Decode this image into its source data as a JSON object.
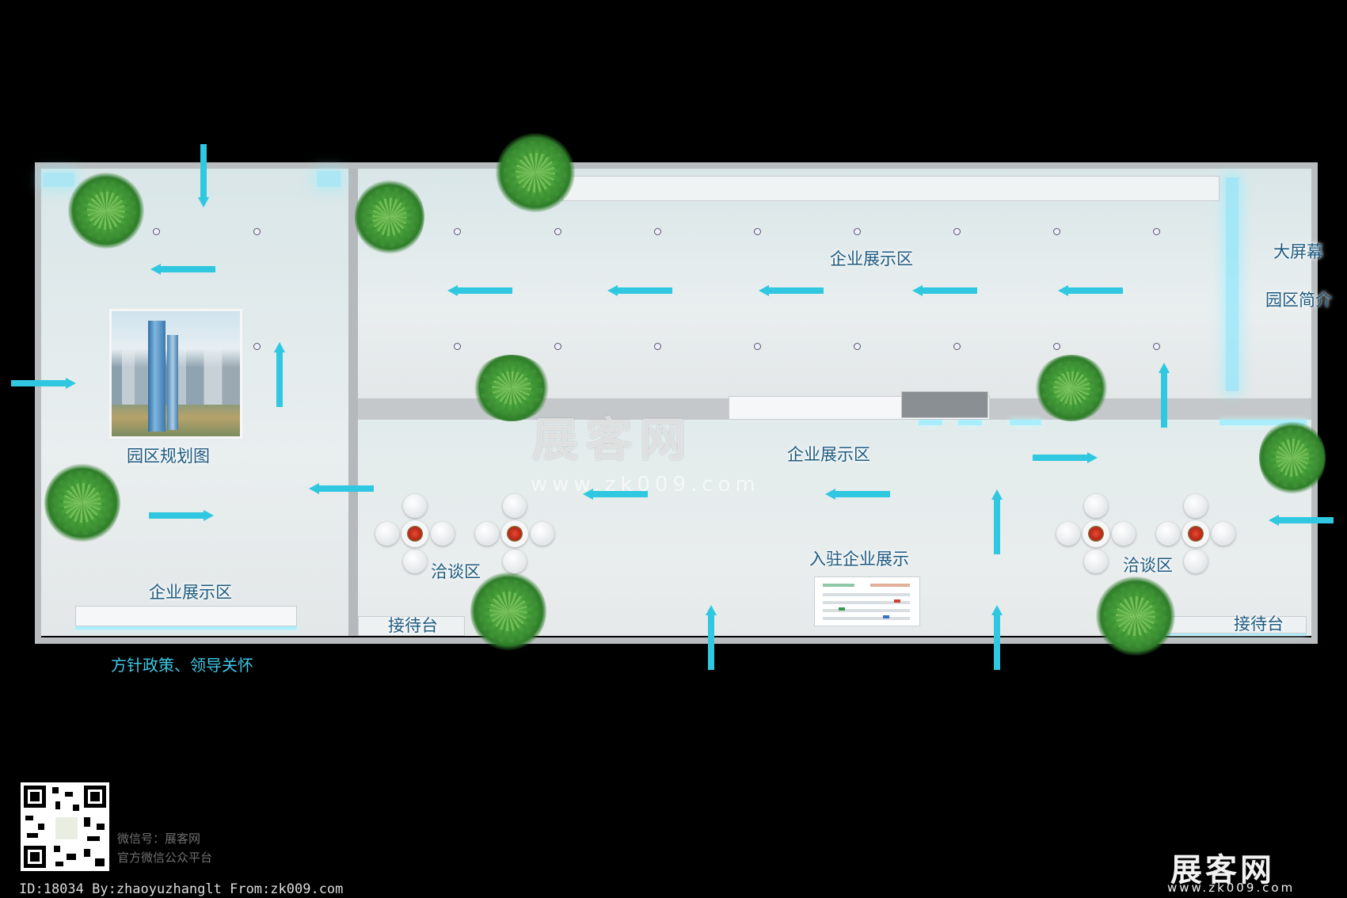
{
  "zones": {
    "enterprise_display_top": "企业展示区",
    "big_screen": "大屏幕",
    "park_intro": "园区简介",
    "park_plan": "园区规划图",
    "enterprise_display_mid": "企业展示区",
    "enterprise_display_left": "企业展示区",
    "negotiation_left": "洽谈区",
    "negotiation_right": "洽谈区",
    "resident_enterprise": "入驻企业展示",
    "reception_left": "接待台",
    "reception_right": "接待台",
    "policy_caption": "方针政策、领导关怀"
  },
  "watermark": {
    "brand": "展客网",
    "url": "www.zk009.com"
  },
  "footer": {
    "wechat_line1": "微信号：展客网",
    "wechat_line2": "官方微信公众平台",
    "id_line": "ID:18034 By:zhaoyuzhanglt From:zk009.com",
    "logo_text": "展客网",
    "logo_url": "www.zk009.com"
  },
  "colors": {
    "background": "#000000",
    "arrow": "#2fc8e0",
    "glow": "#7fe6ff",
    "label": "#1d5a80"
  },
  "icons": {
    "arrow": "flow-direction-arrow",
    "plant": "potted-plant",
    "table_set": "round-table-with-chairs",
    "qr": "qr-code"
  }
}
